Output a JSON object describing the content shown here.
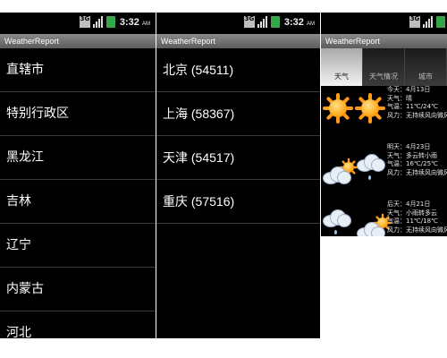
{
  "app_title": "WeatherReport",
  "status": {
    "time": "3:32",
    "ampm": "AM",
    "network": "3G"
  },
  "provinces": [
    "直辖市",
    "特别行政区",
    "黑龙江",
    "吉林",
    "辽宁",
    "内蒙古",
    "河北"
  ],
  "cities": [
    "北京 (54511)",
    "上海 (58367)",
    "天津 (54517)",
    "重庆 (57516)"
  ],
  "tabs": [
    "天气",
    "天气情况",
    "城市"
  ],
  "forecast": [
    {
      "date": "今天：4月13日",
      "weather": "天气：晴",
      "temp": "气温：11℃/24℃",
      "wind": "风力：无持续风向微风",
      "icons": [
        "sun-icon",
        "sun-icon"
      ]
    },
    {
      "date": "明天：4月23日",
      "weather": "天气：多云转小雨",
      "temp": "气温：16℃/25℃",
      "wind": "风力：无持续风向微风",
      "icons": [
        "partly-cloudy-icon",
        "cloud-rain-icon"
      ]
    },
    {
      "date": "后天：4月21日",
      "weather": "天气：小雨转多云",
      "temp": "气温：11℃/18℃",
      "wind": "风力：无持续风向微风",
      "icons": [
        "cloud-rain-icon",
        "partly-cloudy-icon"
      ]
    }
  ]
}
